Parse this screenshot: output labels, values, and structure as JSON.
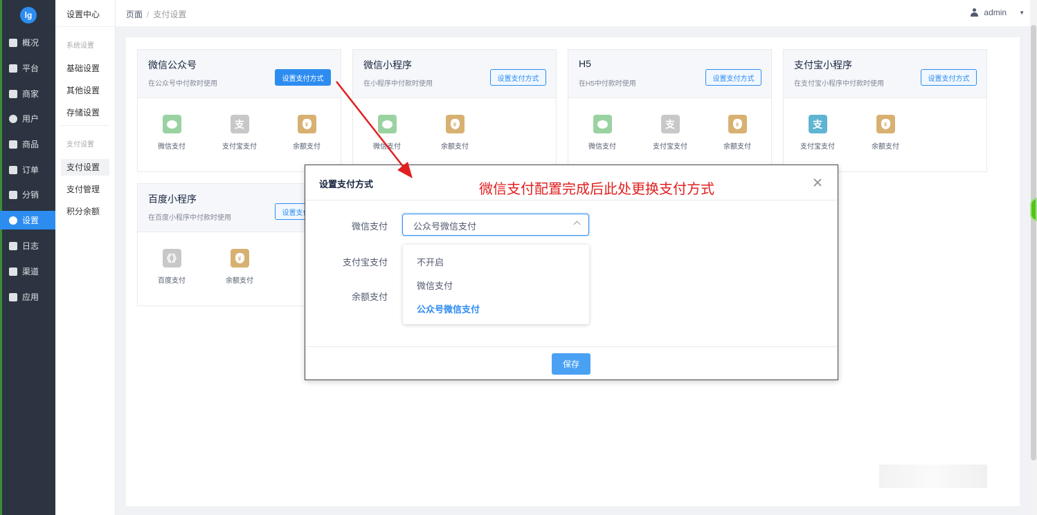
{
  "sidebar": {
    "logo": "lg",
    "items": [
      {
        "label": "概况",
        "icon": "chart-screen-icon"
      },
      {
        "label": "平台",
        "icon": "monitor-icon"
      },
      {
        "label": "商家",
        "icon": "store-icon"
      },
      {
        "label": "用户",
        "icon": "user-icon"
      },
      {
        "label": "商品",
        "icon": "goods-icon"
      },
      {
        "label": "订单",
        "icon": "order-icon"
      },
      {
        "label": "分销",
        "icon": "distribution-icon"
      },
      {
        "label": "设置",
        "icon": "gear-icon",
        "active": true
      },
      {
        "label": "日志",
        "icon": "log-icon"
      },
      {
        "label": "渠道",
        "icon": "channel-icon"
      },
      {
        "label": "应用",
        "icon": "apps-icon"
      }
    ]
  },
  "subnav": {
    "title": "设置中心",
    "group1": "系统设置",
    "group1_items": [
      "基础设置",
      "其他设置",
      "存储设置"
    ],
    "group2": "支付设置",
    "group2_items": [
      "支付设置",
      "支付管理",
      "积分余额"
    ]
  },
  "header": {
    "breadcrumb_home": "页面",
    "breadcrumb_sep": "/",
    "breadcrumb_current": "支付设置",
    "username": "admin"
  },
  "cards": [
    {
      "title": "微信公众号",
      "desc": "在公众号中付款时使用",
      "button": "设置支付方式",
      "methods": [
        {
          "label": "微信支付",
          "icon": "wechat-pay-icon"
        },
        {
          "label": "支付宝支付",
          "icon": "alipay-icon"
        },
        {
          "label": "余额支付",
          "icon": "balance-pay-icon"
        }
      ]
    },
    {
      "title": "微信小程序",
      "desc": "在小程序中付款时使用",
      "button": "设置支付方式",
      "methods": [
        {
          "label": "微信支付",
          "icon": "wechat-pay-icon"
        },
        {
          "label": "余额支付",
          "icon": "balance-pay-icon"
        }
      ]
    },
    {
      "title": "H5",
      "desc": "在H5中付款时使用",
      "button": "设置支付方式",
      "methods": [
        {
          "label": "微信支付",
          "icon": "wechat-pay-icon"
        },
        {
          "label": "支付宝支付",
          "icon": "alipay-icon"
        },
        {
          "label": "余额支付",
          "icon": "balance-pay-icon"
        }
      ]
    },
    {
      "title": "支付宝小程序",
      "desc": "在支付宝小程序中付款时使用",
      "button": "设置支付方式",
      "methods": [
        {
          "label": "支付宝支付",
          "icon": "alipay-icon"
        },
        {
          "label": "余额支付",
          "icon": "balance-pay-icon"
        }
      ]
    },
    {
      "title": "百度小程序",
      "desc": "在百度小程序中付款时使用",
      "button": "设置支付方式",
      "methods": [
        {
          "label": "百度支付",
          "icon": "baidu-pay-icon"
        },
        {
          "label": "余额支付",
          "icon": "balance-pay-icon"
        }
      ]
    }
  ],
  "annotation": "微信支付配置完成后此处更换支付方式",
  "modal": {
    "title": "设置支付方式",
    "fields": [
      "微信支付",
      "支付宝支付",
      "余额支付"
    ],
    "wechat_selected": "公众号微信支付",
    "options": [
      "不开启",
      "微信支付",
      "公众号微信支付"
    ],
    "selected_option": "公众号微信支付",
    "save": "保存"
  },
  "colors": {
    "primary": "#2d8cf0",
    "sidebar": "#2b3440",
    "annotation": "#e02020"
  }
}
